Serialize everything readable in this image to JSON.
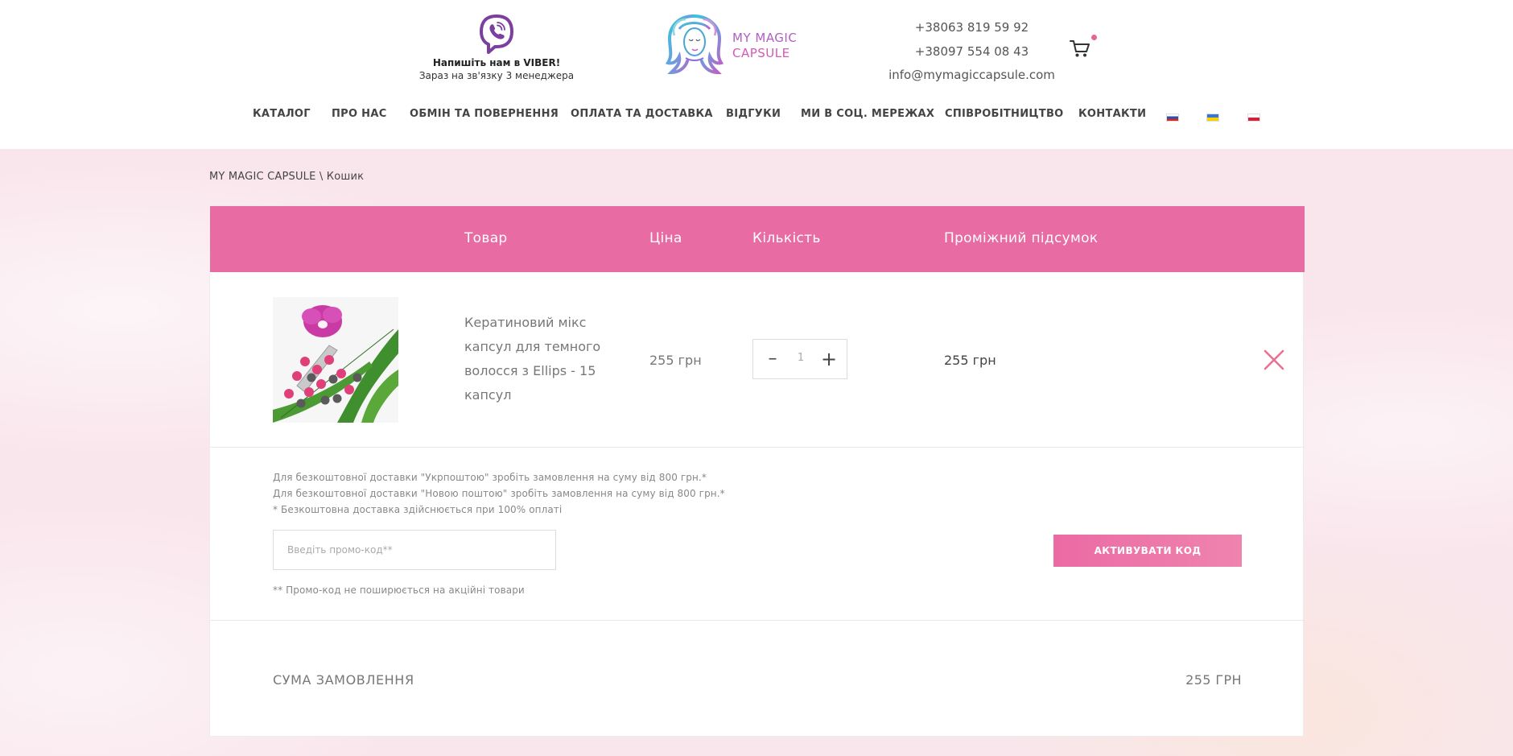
{
  "header": {
    "viber_title": "Напишіть нам в VIBER!",
    "viber_subtitle": "Зараз на зв'язку 3 менеджера",
    "logo_line1": "MY MAGIC",
    "logo_line2": "CAPSULE",
    "phone1": "+38063 819 59 92",
    "phone2": "+38097 554 08 43",
    "email": "info@mymagiccapsule.com",
    "cart_icon": "cart-icon"
  },
  "nav": {
    "items": [
      "КАТАЛОГ",
      "ПРО НАС",
      "ОБМІН ТА ПОВЕРНЕННЯ",
      "ОПЛАТА ТА ДОСТАВКА",
      "ВІДГУКИ",
      "МИ В СОЦ. МЕРЕЖАХ",
      "СПІВРОБІТНИЦТВО",
      "КОНТАКТИ"
    ],
    "languages": [
      "ru-flag",
      "ua-flag",
      "pl-flag"
    ]
  },
  "breadcrumb": "MY MAGIC CAPSULE \\ Кошик",
  "cart": {
    "columns": [
      "Товар",
      "Ціна",
      "Кількість",
      "Проміжний підсумок"
    ],
    "items": [
      {
        "name": "Кератиновий мікс капсул для темного волосся з Ellips - 15 капсул",
        "price": "255 грн",
        "quantity": "1",
        "subtotal": "255 грн"
      }
    ],
    "qty_minus": "–",
    "qty_plus": "+"
  },
  "promo": {
    "note1": "Для безкоштовної доставки \"Укрпоштою\" зробіть замовлення на суму від 800 грн.*",
    "note2": "Для безкоштовної доставки \"Новою поштою\" зробіть замовлення на суму від 800 грн.*",
    "note3": "* Безкоштовна доставка здійснюється при 100% оплаті",
    "input_placeholder": "Введіть промо-код**",
    "button_label": "АКТИВУВАТИ КОД",
    "footnote": "** Промо-код не поширюється на акційні товари"
  },
  "total": {
    "label": "СУМА ЗАМОВЛЕННЯ",
    "value": "255 ГРН"
  },
  "colors": {
    "accent": "#e86ba3",
    "background": "#f9e6ec",
    "viber": "#7b3fa0"
  }
}
